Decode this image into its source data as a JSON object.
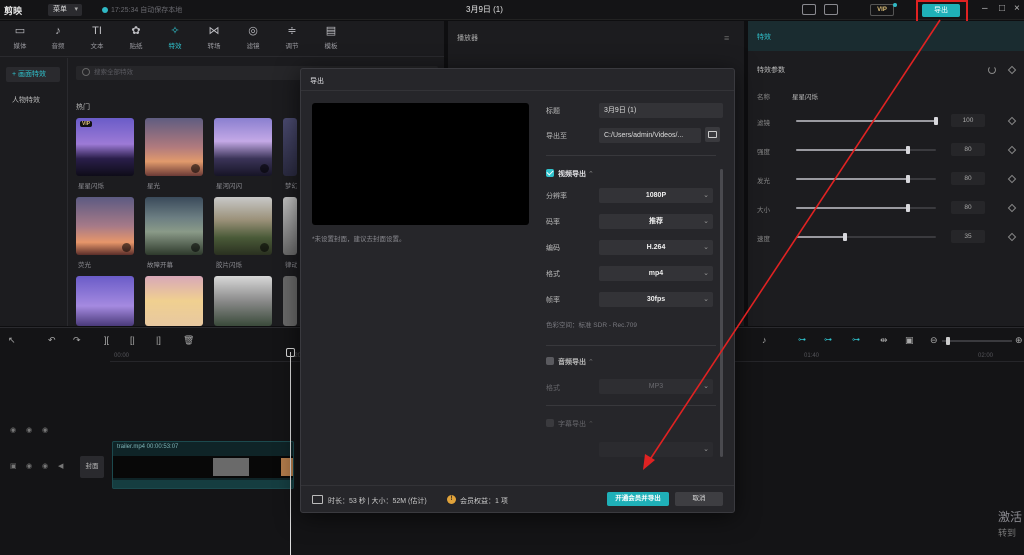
{
  "topbar": {
    "logo": "剪映",
    "menu_label": "菜单",
    "autosave": "17:25:34 自动保存本地",
    "doc_title": "3月9日 (1)",
    "vip": "VIP",
    "export_label": "导出"
  },
  "media_tabs": [
    {
      "icon": "▭",
      "label": "媒体"
    },
    {
      "icon": "♪",
      "label": "音频"
    },
    {
      "icon": "TI",
      "label": "文本"
    },
    {
      "icon": "✿",
      "label": "贴纸"
    },
    {
      "icon": "✧",
      "label": "特效"
    },
    {
      "icon": "⋈",
      "label": "转场"
    },
    {
      "icon": "◎",
      "label": "滤镜"
    },
    {
      "icon": "≑",
      "label": "调节"
    },
    {
      "icon": "▤",
      "label": "模板"
    }
  ],
  "media_side": {
    "items": [
      "+ 画面特效",
      "人物特效"
    ]
  },
  "media_search_placeholder": "搜索全部特效",
  "media_section": "热门",
  "effects": [
    {
      "label": "星星闪烁",
      "vip": "VIP"
    },
    {
      "label": "星光",
      "vip": ""
    },
    {
      "label": "星河闪闪",
      "vip": ""
    },
    {
      "label": "梦幻",
      "vip": ""
    },
    {
      "label": "荧光",
      "vip": ""
    },
    {
      "label": "故障开幕",
      "vip": ""
    },
    {
      "label": "胶片闪烁",
      "vip": ""
    },
    {
      "label": "律动",
      "vip": ""
    }
  ],
  "player": {
    "title": "播放器"
  },
  "effect_panel": {
    "title": "特效",
    "section": "特效参数",
    "name_label": "名称",
    "name_value": "星星闪烁",
    "params": [
      {
        "label": "滤镜",
        "value": "100",
        "level": 1.0
      },
      {
        "label": "强度",
        "value": "80",
        "level": 0.8
      },
      {
        "label": "发光",
        "value": "80",
        "level": 0.8
      },
      {
        "label": "大小",
        "value": "80",
        "level": 0.8
      },
      {
        "label": "速度",
        "value": "35",
        "level": 0.35
      }
    ]
  },
  "timeline": {
    "ruler": [
      "00:00",
      "00:20",
      "01:40",
      "02:00"
    ],
    "cover_label": "封面",
    "clip_label": "trailer.mp4  00:00:53:07"
  },
  "watermark": {
    "line1": "激活",
    "line2": "转到"
  },
  "dialog": {
    "title": "导出",
    "cover_note": "*未设置封面，建议去封面设置。",
    "fields": {
      "title_label": "标题",
      "title_value": "3月9日 (1)",
      "path_label": "导出至",
      "path_value": "C:/Users/admin/Videos/..."
    },
    "video_section": "视频导出",
    "video_fields": [
      {
        "label": "分辨率",
        "value": "1080P"
      },
      {
        "label": "码率",
        "value": "推荐"
      },
      {
        "label": "编码",
        "value": "H.264"
      },
      {
        "label": "格式",
        "value": "mp4"
      },
      {
        "label": "帧率",
        "value": "30fps"
      }
    ],
    "color_space": "色彩空间：标准 SDR - Rec.709",
    "audio_section": "音频导出",
    "audio_format_label": "格式",
    "audio_format_value": "MP3",
    "subtitle_section": "字幕导出",
    "footer": {
      "info": "时长：53 秒 | 大小：52M (估计)",
      "member": "会员权益：1 项",
      "primary": "开通会员并导出",
      "cancel": "取消"
    }
  },
  "colors": {
    "accent": "#1fb0b8",
    "highlight_box": "#e02222",
    "background": "#0e0e10"
  }
}
